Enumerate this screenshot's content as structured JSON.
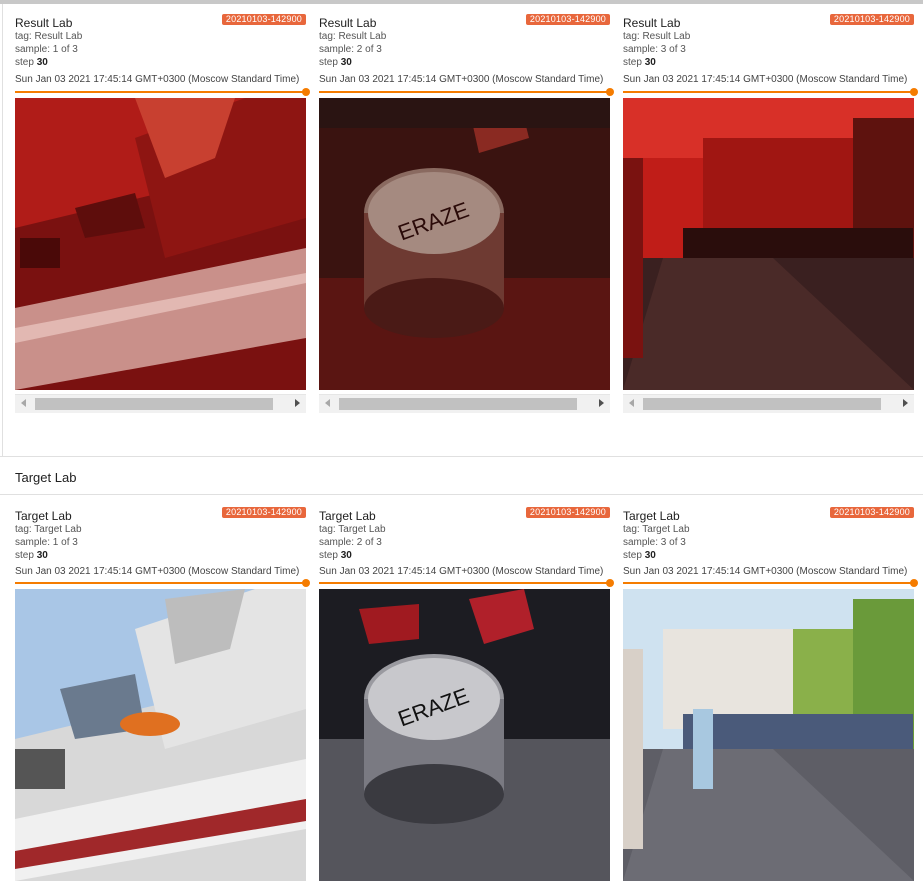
{
  "result_section": {
    "cards": [
      {
        "title": "Result Lab",
        "run": "20210103-142900",
        "tag": "tag: Result Lab",
        "sample": "sample: 1 of 3",
        "step_label": "step",
        "step": "30",
        "time": "Sun Jan 03 2021 17:45:14 GMT+0300 (Moscow Standard Time)",
        "image": "ship-photo"
      },
      {
        "title": "Result Lab",
        "run": "20210103-142900",
        "tag": "tag: Result Lab",
        "sample": "sample: 2 of 3",
        "step_label": "step",
        "step": "30",
        "time": "Sun Jan 03 2021 17:45:14 GMT+0300 (Moscow Standard Time)",
        "image": "drum-photo"
      },
      {
        "title": "Result Lab",
        "run": "20210103-142900",
        "tag": "tag: Result Lab",
        "sample": "sample: 3 of 3",
        "step_label": "step",
        "step": "30",
        "time": "Sun Jan 03 2021 17:45:14 GMT+0300 (Moscow Standard Time)",
        "image": "street-photo"
      }
    ]
  },
  "target_section": {
    "title": "Target Lab",
    "cards": [
      {
        "title": "Target Lab",
        "run": "20210103-142900",
        "tag": "tag: Target Lab",
        "sample": "sample: 1 of 3",
        "step_label": "step",
        "step": "30",
        "time": "Sun Jan 03 2021 17:45:14 GMT+0300 (Moscow Standard Time)",
        "image": "ship-photo"
      },
      {
        "title": "Target Lab",
        "run": "20210103-142900",
        "tag": "tag: Target Lab",
        "sample": "sample: 2 of 3",
        "step_label": "step",
        "step": "30",
        "time": "Sun Jan 03 2021 17:45:14 GMT+0300 (Moscow Standard Time)",
        "image": "drum-photo"
      },
      {
        "title": "Target Lab",
        "run": "20210103-142900",
        "tag": "tag: Target Lab",
        "sample": "sample: 3 of 3",
        "step_label": "step",
        "step": "30",
        "time": "Sun Jan 03 2021 17:45:14 GMT+0300 (Moscow Standard Time)",
        "image": "street-photo"
      }
    ]
  },
  "colors": {
    "accent": "#f57c00",
    "run_badge": "#e8673c",
    "result_tint": "#c0201c"
  }
}
